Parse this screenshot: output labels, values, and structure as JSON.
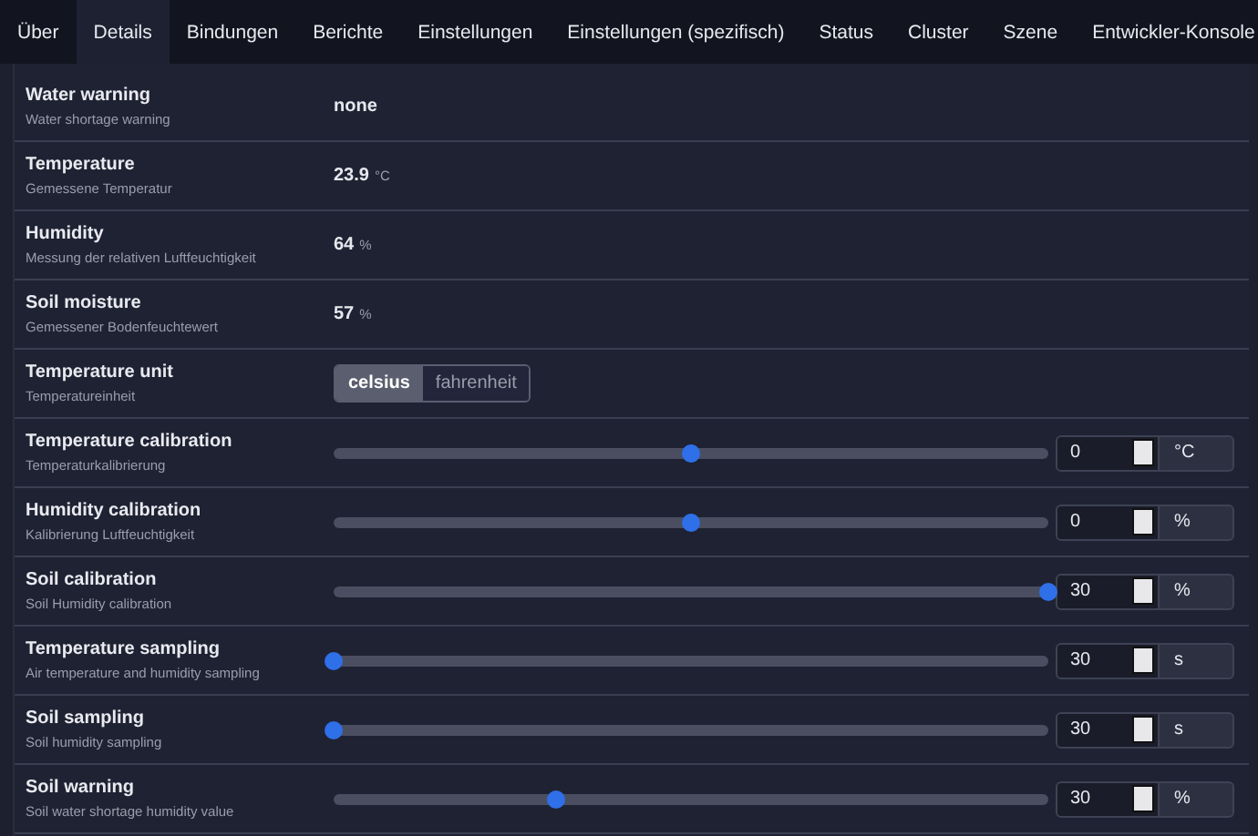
{
  "tabs": [
    {
      "label": "Über",
      "selected": false
    },
    {
      "label": "Details",
      "selected": true
    },
    {
      "label": "Bindungen",
      "selected": false
    },
    {
      "label": "Berichte",
      "selected": false
    },
    {
      "label": "Einstellungen",
      "selected": false
    },
    {
      "label": "Einstellungen (spezifisch)",
      "selected": false
    },
    {
      "label": "Status",
      "selected": false
    },
    {
      "label": "Cluster",
      "selected": false
    },
    {
      "label": "Szene",
      "selected": false
    },
    {
      "label": "Entwickler-Konsole",
      "selected": false
    }
  ],
  "rows": [
    {
      "kind": "reading",
      "name": "Water warning",
      "description": "Water shortage warning",
      "value": "none"
    },
    {
      "kind": "reading",
      "name": "Temperature",
      "description": "Gemessene Temperatur",
      "value": "23.9",
      "unit": "°C"
    },
    {
      "kind": "reading",
      "name": "Humidity",
      "description": "Messung der relativen Luftfeuchtigkeit",
      "value": "64",
      "unit": "%"
    },
    {
      "kind": "reading",
      "name": "Soil moisture",
      "description": "Gemessener Bodenfeuchtewert",
      "value": "57",
      "unit": "%"
    },
    {
      "kind": "toggle",
      "name": "Temperature unit",
      "description": "Temperatureinheit",
      "options": [
        {
          "label": "celsius",
          "selected": true
        },
        {
          "label": "fahrenheit",
          "selected": false
        }
      ]
    },
    {
      "kind": "slider",
      "name": "Temperature calibration",
      "description": "Temperaturkalibrierung",
      "level": 0.5,
      "value": "0",
      "unit": "°C"
    },
    {
      "kind": "slider",
      "name": "Humidity calibration",
      "description": "Kalibrierung Luftfeuchtigkeit",
      "level": 0.5,
      "value": "0",
      "unit": "%"
    },
    {
      "kind": "slider",
      "name": "Soil calibration",
      "description": "Soil Humidity calibration",
      "level": 1,
      "value": "30",
      "unit": "%"
    },
    {
      "kind": "slider",
      "name": "Temperature sampling",
      "description": "Air temperature and humidity sampling",
      "level": 0,
      "value": "30",
      "unit": "s"
    },
    {
      "kind": "slider",
      "name": "Soil sampling",
      "description": "Soil humidity sampling",
      "level": 0,
      "value": "30",
      "unit": "s"
    },
    {
      "kind": "slider",
      "name": "Soil warning",
      "description": "Soil water shortage humidity value",
      "level": 0.31,
      "value": "30",
      "unit": "%"
    }
  ]
}
